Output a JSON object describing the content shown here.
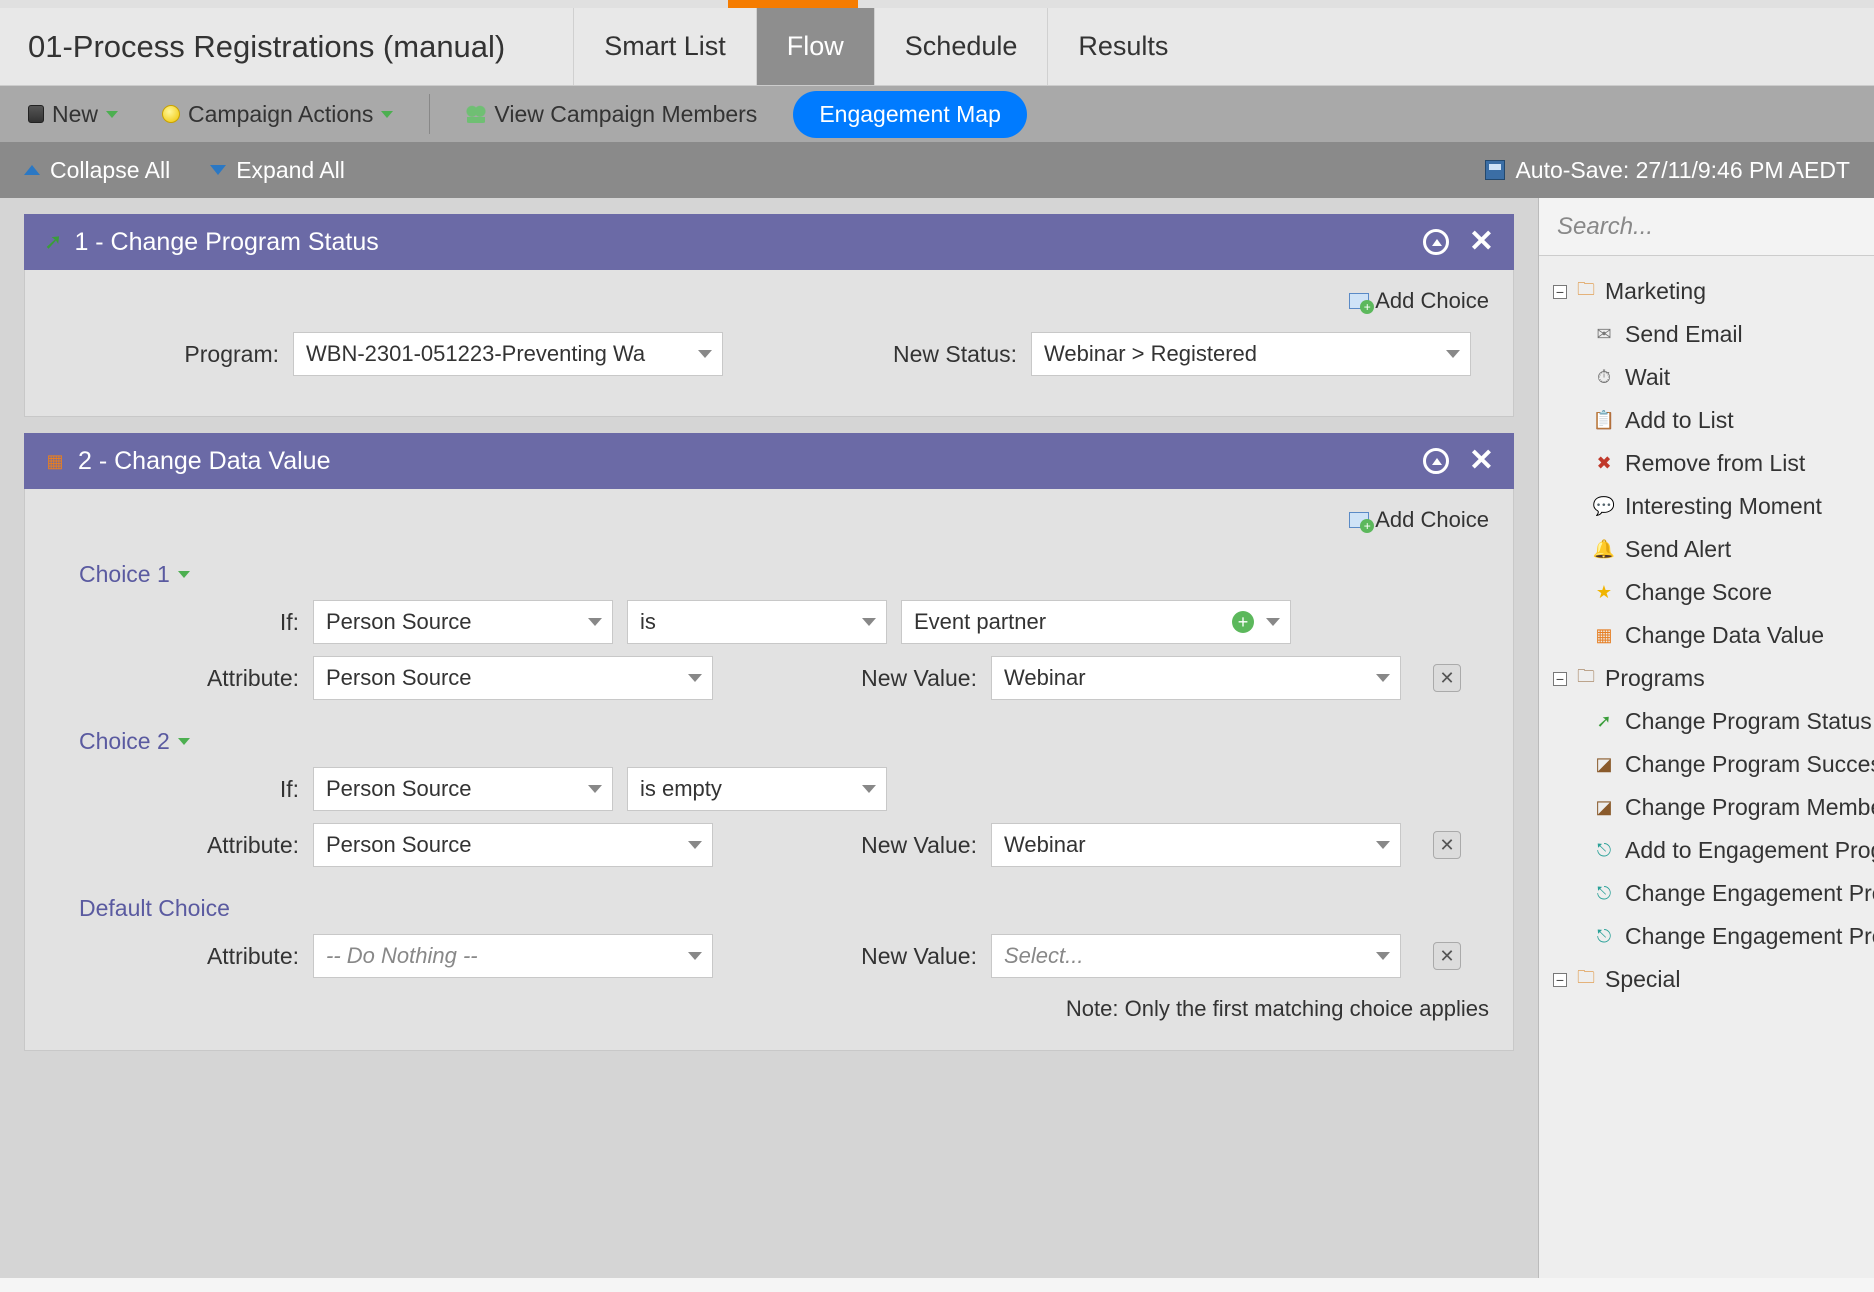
{
  "page_title": "01-Process Registrations (manual)",
  "tabs": [
    "Smart List",
    "Flow",
    "Schedule",
    "Results"
  ],
  "active_tab_index": 1,
  "toolbar": {
    "new_label": "New",
    "campaign_actions_label": "Campaign Actions",
    "view_members_label": "View Campaign Members",
    "engagement_map_label": "Engagement Map"
  },
  "subbar": {
    "collapse_label": "Collapse All",
    "expand_label": "Expand All",
    "autosave_label": "Auto-Save: 27/11/9:46 PM AEDT"
  },
  "steps": [
    {
      "title": "1 - Change Program Status",
      "add_choice_label": "Add Choice",
      "rows": {
        "program_label": "Program:",
        "program_value": "WBN-2301-051223-Preventing Wa",
        "new_status_label": "New Status:",
        "new_status_value": "Webinar > Registered"
      }
    },
    {
      "title": "2 - Change Data Value",
      "add_choice_label": "Add Choice",
      "choices": [
        {
          "label": "Choice 1",
          "if_label": "If:",
          "if_field": "Person Source",
          "if_operator": "is",
          "if_value": "Event partner",
          "attribute_label": "Attribute:",
          "attribute_value": "Person Source",
          "new_value_label": "New Value:",
          "new_value": "Webinar"
        },
        {
          "label": "Choice 2",
          "if_label": "If:",
          "if_field": "Person Source",
          "if_operator": "is empty",
          "if_value": "",
          "attribute_label": "Attribute:",
          "attribute_value": "Person Source",
          "new_value_label": "New Value:",
          "new_value": "Webinar"
        }
      ],
      "default_choice": {
        "label": "Default Choice",
        "attribute_label": "Attribute:",
        "attribute_value": "-- Do Nothing --",
        "new_value_label": "New Value:",
        "new_value_placeholder": "Select..."
      },
      "note": "Note: Only the first matching choice applies"
    }
  ],
  "sidebar": {
    "search_placeholder": "Search...",
    "groups": [
      {
        "name": "Marketing",
        "items": [
          "Send Email",
          "Wait",
          "Add to List",
          "Remove from List",
          "Interesting Moment",
          "Send Alert",
          "Change Score",
          "Change Data Value"
        ]
      },
      {
        "name": "Programs",
        "items": [
          "Change Program Status",
          "Change Program Success",
          "Change Program Member Data",
          "Add to Engagement Program",
          "Change Engagement Program Stream",
          "Change Engagement Program Cadence"
        ]
      },
      {
        "name": "Special",
        "items": []
      }
    ]
  }
}
